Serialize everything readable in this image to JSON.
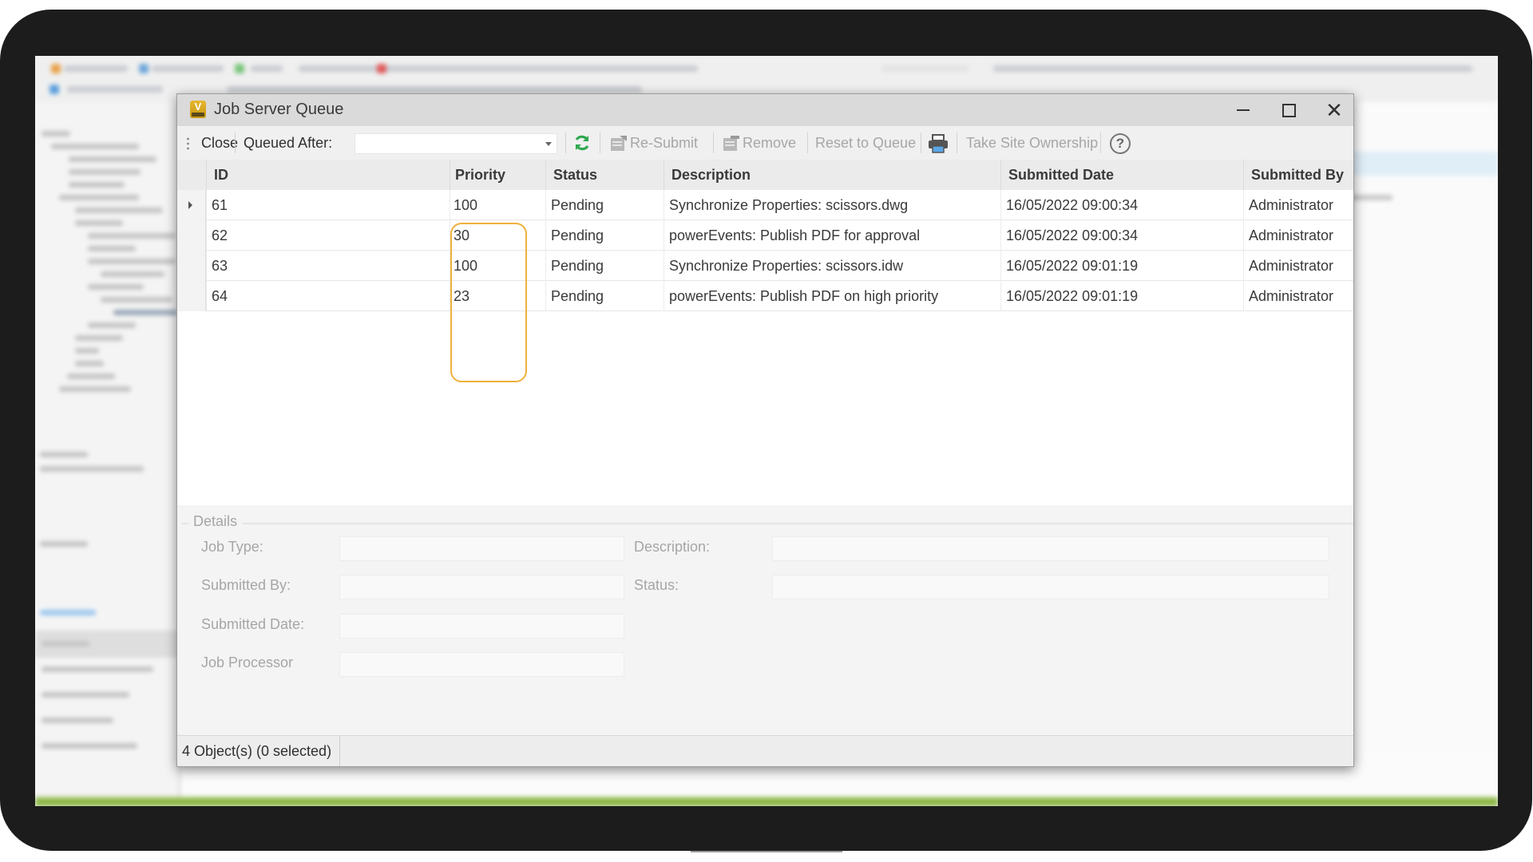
{
  "dialog": {
    "title": "Job Server Queue",
    "app_icon_letter": "V",
    "window_controls": {
      "minimize": "minimize",
      "maximize": "maximize",
      "close": "✕"
    }
  },
  "toolbar": {
    "close_label": "Close",
    "queued_after_label": "Queued After:",
    "queued_after_value": "",
    "resubmit_label": "Re-Submit",
    "remove_label": "Remove",
    "reset_label": "Reset to Queue",
    "take_ownership_label": "Take Site Ownership",
    "help_glyph": "?",
    "icons": [
      "grip-icon",
      "refresh-icon",
      "resubmit-icon",
      "remove-icon",
      "print-icon",
      "help-icon"
    ],
    "accent_refresh": "#2fa84f"
  },
  "grid": {
    "columns": [
      "ID",
      "Priority",
      "Status",
      "Description",
      "Submitted Date",
      "Submitted By"
    ],
    "rows": [
      {
        "id": "61",
        "priority": "100",
        "status": "Pending",
        "description": "Synchronize Properties: scissors.dwg",
        "submitted_date": "16/05/2022 09:00:34",
        "submitted_by": "Administrator",
        "current": true
      },
      {
        "id": "62",
        "priority": "30",
        "status": "Pending",
        "description": "powerEvents: Publish PDF for approval",
        "submitted_date": "16/05/2022 09:00:34",
        "submitted_by": "Administrator",
        "current": false
      },
      {
        "id": "63",
        "priority": "100",
        "status": "Pending",
        "description": "Synchronize Properties: scissors.idw",
        "submitted_date": "16/05/2022 09:01:19",
        "submitted_by": "Administrator",
        "current": false
      },
      {
        "id": "64",
        "priority": "23",
        "status": "Pending",
        "description": "powerEvents: Publish PDF on high priority",
        "submitted_date": "16/05/2022 09:01:19",
        "submitted_by": "Administrator",
        "current": false
      }
    ],
    "highlight_color": "#f0b13c",
    "scroll_position_fraction": 0.0,
    "scroll_visible_fraction": 0.85,
    "scroll_left_glyph": "‹",
    "scroll_right_glyph": "›"
  },
  "details": {
    "legend": "Details",
    "fields": {
      "job_type": {
        "label": "Job Type:",
        "value": ""
      },
      "description": {
        "label": "Description:",
        "value": ""
      },
      "submitted_by": {
        "label": "Submitted By:",
        "value": ""
      },
      "status": {
        "label": "Status:",
        "value": ""
      },
      "submitted_date": {
        "label": "Submitted Date:",
        "value": ""
      },
      "job_processor": {
        "label": "Job Processor",
        "value": ""
      }
    }
  },
  "statusbar": {
    "text": "4 Object(s) (0 selected)"
  }
}
